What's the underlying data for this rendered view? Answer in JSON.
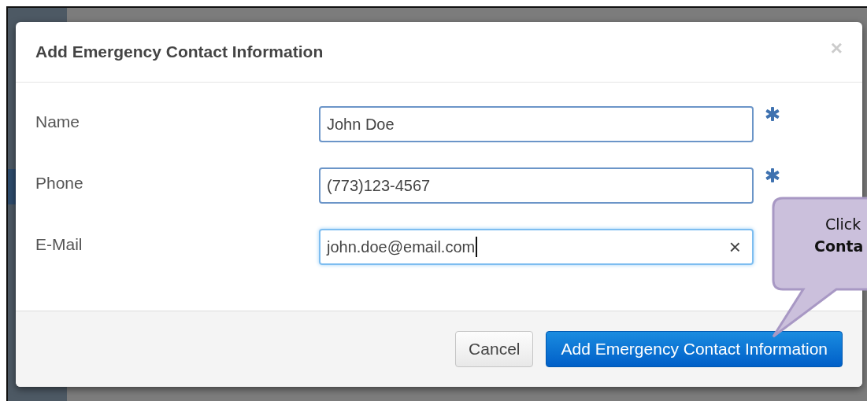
{
  "dialog": {
    "title": "Add Emergency Contact Information",
    "close": "×"
  },
  "fields": [
    {
      "label": "Name",
      "value": "John Doe",
      "required": true,
      "focused": false
    },
    {
      "label": "Phone",
      "value": "(773)123-4567",
      "required": true,
      "focused": false
    },
    {
      "label": "E-Mail",
      "value": "john.doe@email.com",
      "required": false,
      "focused": true,
      "clear": "×"
    }
  ],
  "buttons": [
    {
      "label": "Cancel",
      "kind": "default"
    },
    {
      "label": "Add Emergency Contact Information",
      "kind": "primary"
    }
  ],
  "callout": {
    "lines": [
      {
        "text": "Click",
        "bold": false
      },
      {
        "text": "Conta",
        "bold": true
      }
    ]
  }
}
